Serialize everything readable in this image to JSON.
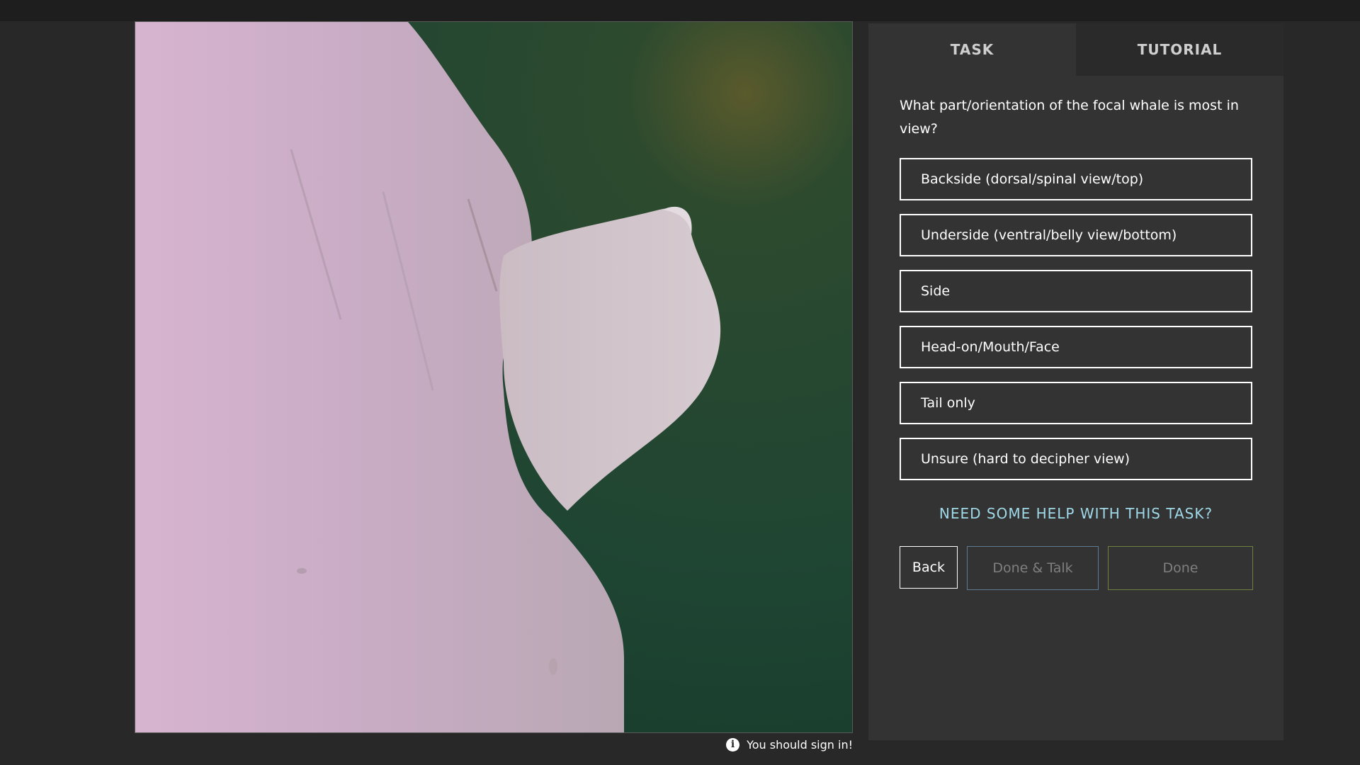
{
  "tabs": {
    "task": "TASK",
    "tutorial": "TUTORIAL"
  },
  "task": {
    "question": "What part/orientation of the focal whale is most in view?",
    "answers": [
      "Backside (dorsal/spinal view/top)",
      "Underside (ventral/belly view/bottom)",
      "Side",
      "Head-on/Mouth/Face",
      "Tail only",
      "Unsure (hard to decipher view)"
    ],
    "help": "NEED SOME HELP WITH THIS TASK?"
  },
  "controls": {
    "back": "Back",
    "done_talk": "Done & Talk",
    "done": "Done"
  },
  "notice": {
    "signin": "You should sign in!",
    "icon": "info-icon"
  },
  "colors": {
    "background": "#282828",
    "panel": "#333333",
    "help_link": "#9fd9e8",
    "done_talk_border": "#5f7a93",
    "done_border": "#6f7f3f"
  }
}
